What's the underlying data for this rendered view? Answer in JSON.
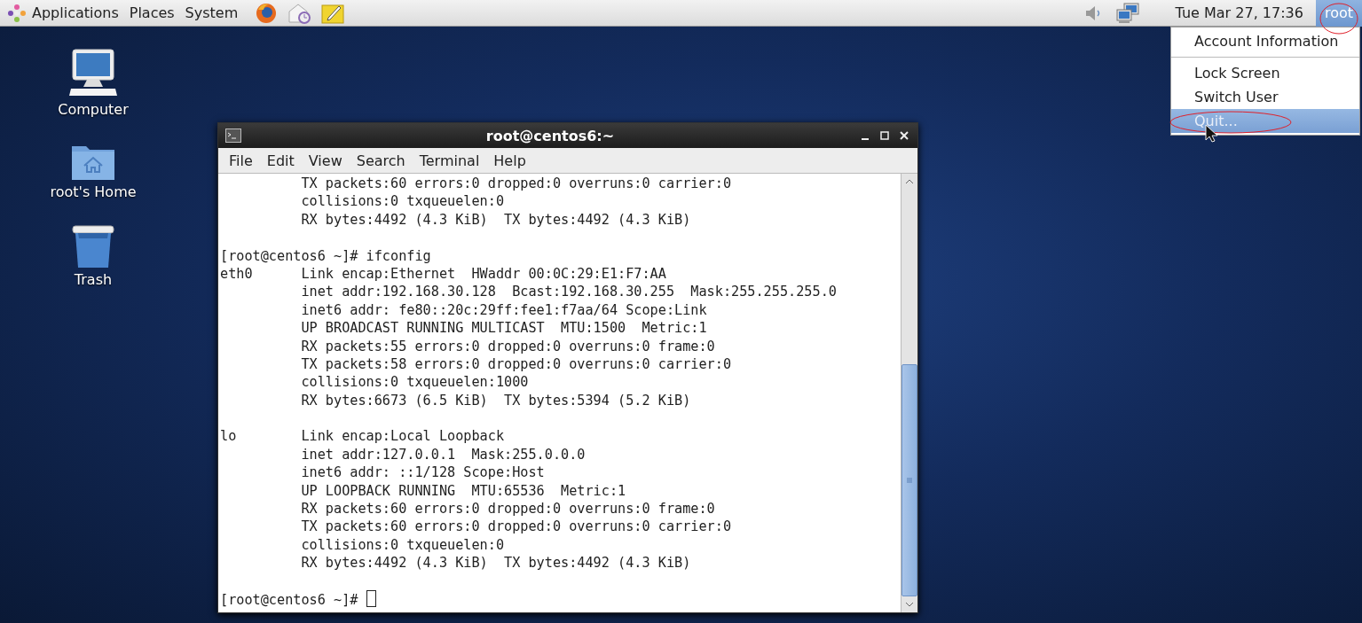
{
  "panel": {
    "menus": [
      "Applications",
      "Places",
      "System"
    ],
    "clock": "Tue Mar 27, 17:36",
    "user": {
      "label": "root",
      "selected": true
    }
  },
  "desktop_icons": [
    {
      "kind": "computer",
      "label": "Computer"
    },
    {
      "kind": "home",
      "label": "root's Home"
    },
    {
      "kind": "trash",
      "label": "Trash"
    }
  ],
  "terminal": {
    "title": "root@centos6:~",
    "menu": [
      "File",
      "Edit",
      "View",
      "Search",
      "Terminal",
      "Help"
    ],
    "blocks": [
      [
        "          TX packets:60 errors:0 dropped:0 overruns:0 carrier:0",
        "          collisions:0 txqueuelen:0",
        "          RX bytes:4492 (4.3 KiB)  TX bytes:4492 (4.3 KiB)"
      ],
      [
        "[root@centos6 ~]# ifconfig",
        "eth0      Link encap:Ethernet  HWaddr 00:0C:29:E1:F7:AA",
        "          inet addr:192.168.30.128  Bcast:192.168.30.255  Mask:255.255.255.0",
        "          inet6 addr: fe80::20c:29ff:fee1:f7aa/64 Scope:Link",
        "          UP BROADCAST RUNNING MULTICAST  MTU:1500  Metric:1",
        "          RX packets:55 errors:0 dropped:0 overruns:0 frame:0",
        "          TX packets:58 errors:0 dropped:0 overruns:0 carrier:0",
        "          collisions:0 txqueuelen:1000",
        "          RX bytes:6673 (6.5 KiB)  TX bytes:5394 (5.2 KiB)"
      ],
      [
        "lo        Link encap:Local Loopback",
        "          inet addr:127.0.0.1  Mask:255.0.0.0",
        "          inet6 addr: ::1/128 Scope:Host",
        "          UP LOOPBACK RUNNING  MTU:65536  Metric:1",
        "          RX packets:60 errors:0 dropped:0 overruns:0 frame:0",
        "          TX packets:60 errors:0 dropped:0 overruns:0 carrier:0",
        "          collisions:0 txqueuelen:0",
        "          RX bytes:4492 (4.3 KiB)  TX bytes:4492 (4.3 KiB)"
      ]
    ],
    "prompt": "[root@centos6 ~]# "
  },
  "user_menu": {
    "groups": [
      [
        {
          "label": "Account Information",
          "selected": false
        }
      ],
      [
        {
          "label": "Lock Screen",
          "selected": false
        },
        {
          "label": "Switch User",
          "selected": false
        },
        {
          "label": "Quit...",
          "selected": true
        }
      ]
    ]
  }
}
